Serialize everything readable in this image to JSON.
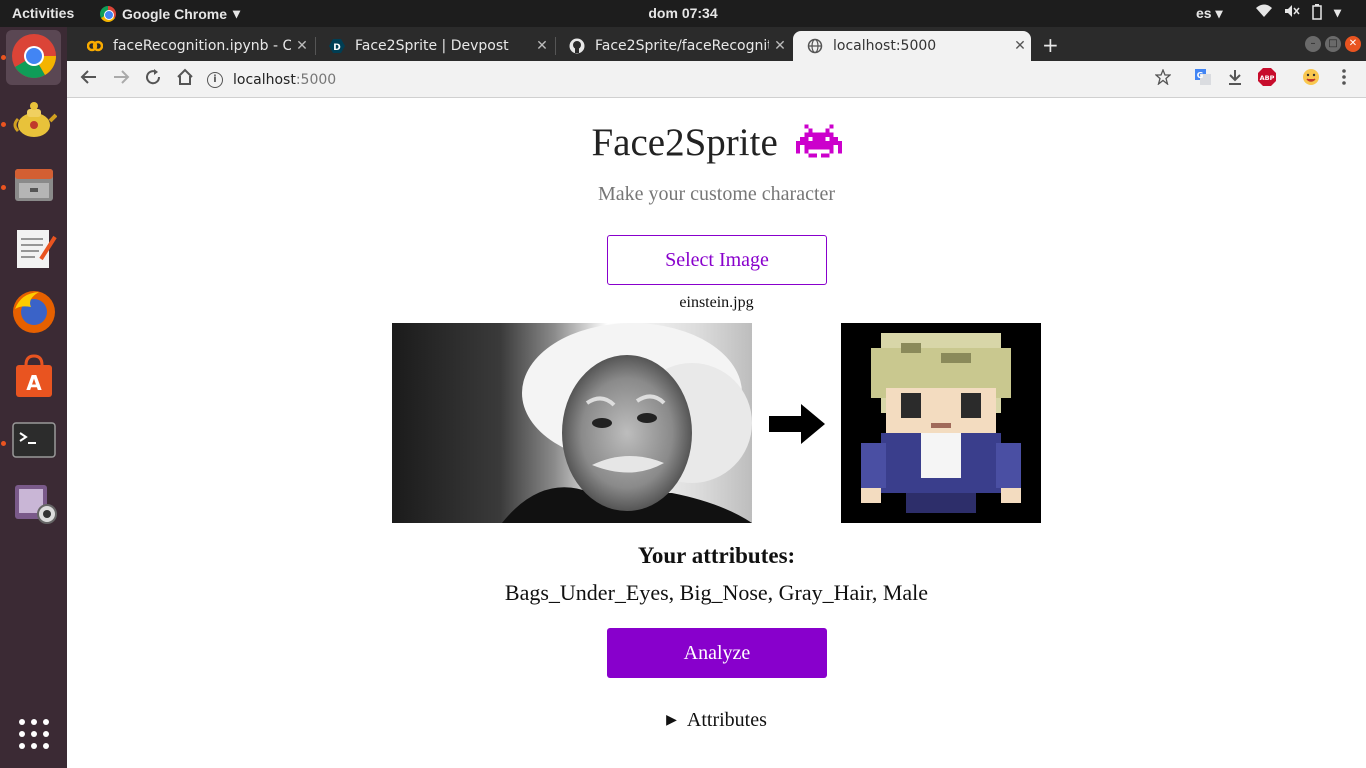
{
  "topbar": {
    "activities": "Activities",
    "app_name": "Google Chrome",
    "clock": "dom 07:34",
    "language": "es"
  },
  "dock": {
    "items": [
      "chrome-icon",
      "teapot-icon",
      "files-icon",
      "text-editor-icon",
      "firefox-icon",
      "software-store-icon",
      "terminal-icon",
      "webcam-icon",
      "app-grid-icon"
    ]
  },
  "tabs": [
    {
      "title": "faceRecognition.ipynb - C",
      "icon": "colab-icon"
    },
    {
      "title": "Face2Sprite | Devpost",
      "icon": "devpost-icon"
    },
    {
      "title": "Face2Sprite/faceRecognit",
      "icon": "github-icon"
    },
    {
      "title": "localhost:5000",
      "icon": "globe-icon"
    }
  ],
  "omnibox": {
    "host": "localhost",
    "port": ":5000"
  },
  "page": {
    "title": "Face2Sprite",
    "subtitle": "Make your custome character",
    "select_label": "Select Image",
    "filename": "einstein.jpg",
    "attributes_heading": "Your attributes:",
    "attributes_list": "Bags_Under_Eyes, Big_Nose, Gray_Hair, Male",
    "analyze_label": "Analyze",
    "details_label": "Attributes"
  },
  "colors": {
    "accent": "#8800cc",
    "invader": "#cc00cc"
  }
}
